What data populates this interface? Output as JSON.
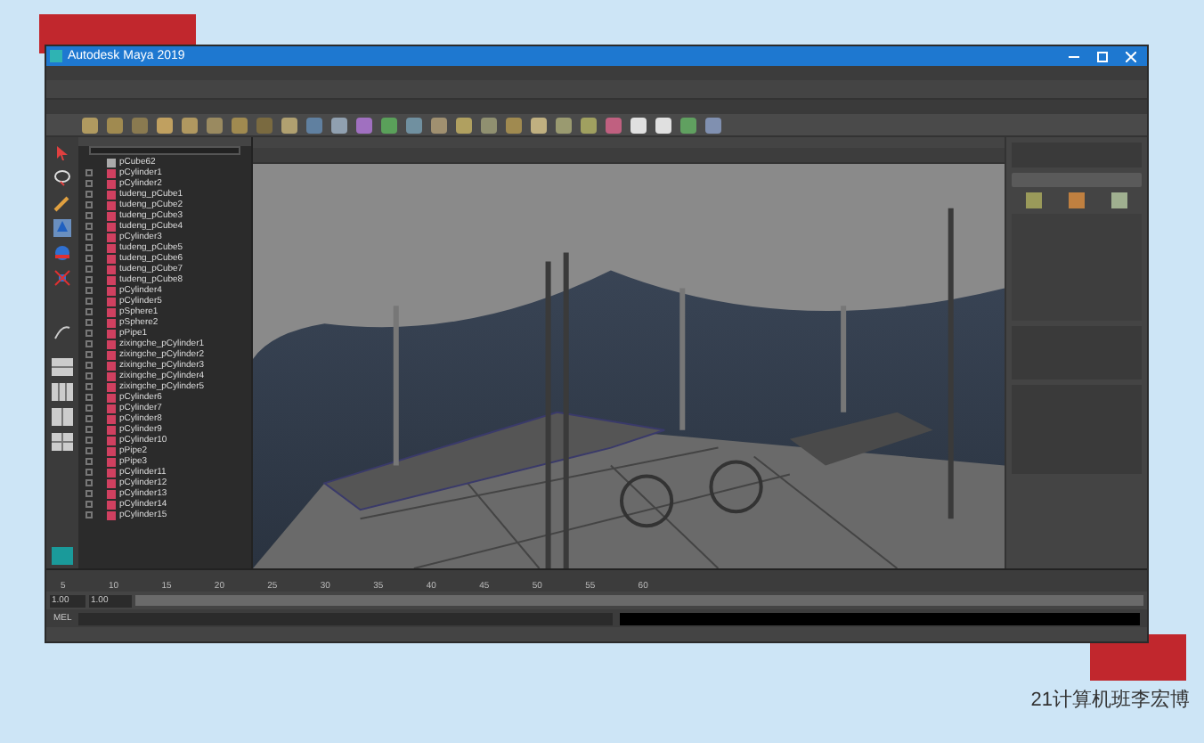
{
  "window": {
    "title": "Autodesk Maya 2019"
  },
  "outliner": {
    "items": [
      {
        "label": "pCube62",
        "kind": "group"
      },
      {
        "label": "pCylinder1",
        "kind": "mesh"
      },
      {
        "label": "pCylinder2",
        "kind": "mesh"
      },
      {
        "label": "tudeng_pCube1",
        "kind": "mesh"
      },
      {
        "label": "tudeng_pCube2",
        "kind": "mesh"
      },
      {
        "label": "tudeng_pCube3",
        "kind": "mesh"
      },
      {
        "label": "tudeng_pCube4",
        "kind": "mesh"
      },
      {
        "label": "pCylinder3",
        "kind": "mesh"
      },
      {
        "label": "tudeng_pCube5",
        "kind": "mesh"
      },
      {
        "label": "tudeng_pCube6",
        "kind": "mesh"
      },
      {
        "label": "tudeng_pCube7",
        "kind": "mesh"
      },
      {
        "label": "tudeng_pCube8",
        "kind": "mesh"
      },
      {
        "label": "pCylinder4",
        "kind": "mesh"
      },
      {
        "label": "pCylinder5",
        "kind": "mesh"
      },
      {
        "label": "pSphere1",
        "kind": "mesh"
      },
      {
        "label": "pSphere2",
        "kind": "mesh"
      },
      {
        "label": "pPipe1",
        "kind": "mesh"
      },
      {
        "label": "zixingche_pCylinder1",
        "kind": "mesh"
      },
      {
        "label": "zixingche_pCylinder2",
        "kind": "mesh"
      },
      {
        "label": "zixingche_pCylinder3",
        "kind": "mesh"
      },
      {
        "label": "zixingche_pCylinder4",
        "kind": "mesh"
      },
      {
        "label": "zixingche_pCylinder5",
        "kind": "mesh"
      },
      {
        "label": "pCylinder6",
        "kind": "mesh"
      },
      {
        "label": "pCylinder7",
        "kind": "mesh"
      },
      {
        "label": "pCylinder8",
        "kind": "mesh"
      },
      {
        "label": "pCylinder9",
        "kind": "mesh"
      },
      {
        "label": "pCylinder10",
        "kind": "mesh"
      },
      {
        "label": "pPipe2",
        "kind": "mesh"
      },
      {
        "label": "pPipe3",
        "kind": "mesh"
      },
      {
        "label": "pCylinder11",
        "kind": "mesh"
      },
      {
        "label": "pCylinder12",
        "kind": "mesh"
      },
      {
        "label": "pCylinder13",
        "kind": "mesh"
      },
      {
        "label": "pCylinder14",
        "kind": "mesh"
      },
      {
        "label": "pCylinder15",
        "kind": "mesh"
      }
    ]
  },
  "timeline": {
    "ticks": [
      "5",
      "10",
      "15",
      "20",
      "25",
      "30",
      "35",
      "40",
      "45",
      "50",
      "55",
      "60"
    ]
  },
  "range": {
    "start": "1.00",
    "inner_start": "1.00",
    "level": 1
  },
  "command_line": {
    "label": "MEL"
  },
  "caption": "21计算机班李宏博"
}
